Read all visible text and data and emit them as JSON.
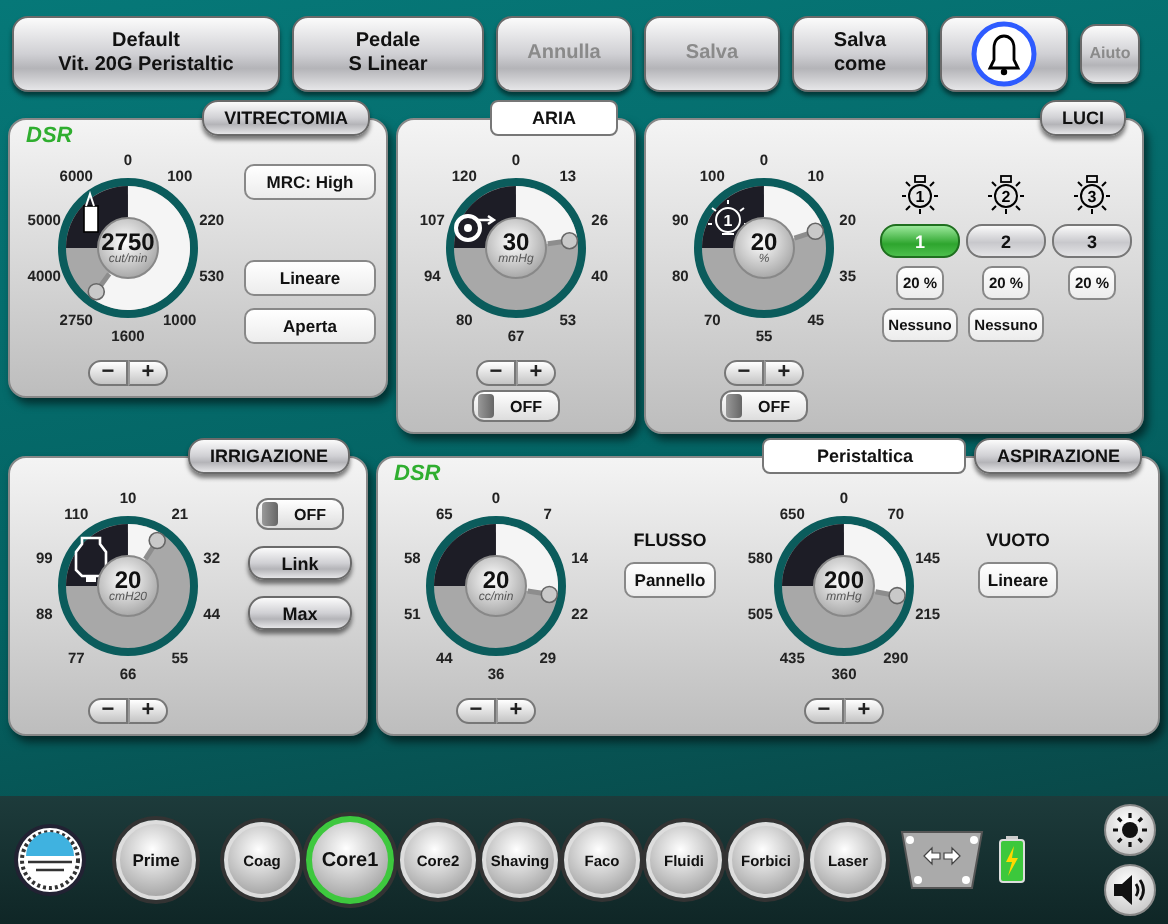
{
  "top_bar": {
    "buttons": [
      {
        "lines": [
          "Default",
          "Vit. 20G Peristaltic"
        ],
        "disabled": false
      },
      {
        "lines": [
          "Pedale",
          "S Linear"
        ],
        "disabled": false
      },
      {
        "lines": [
          "Annulla"
        ],
        "disabled": true
      },
      {
        "lines": [
          "Salva"
        ],
        "disabled": true
      },
      {
        "lines": [
          "Salva",
          "come"
        ],
        "disabled": false
      }
    ],
    "help": {
      "label": "Aiuto",
      "disabled": true
    }
  },
  "vitrectomia": {
    "title": "VITRECTOMIA",
    "brand": "DSR",
    "dial": {
      "value": "2750",
      "unit": "cut/min",
      "ticks": [
        "0",
        "100",
        "220",
        "530",
        "1000",
        "1600",
        "2750",
        "4000",
        "5000",
        "6000"
      ],
      "minus": "−",
      "plus": "+"
    },
    "buttons": [
      "MRC: High",
      "Lineare",
      "Aperta"
    ]
  },
  "aria": {
    "title": "ARIA",
    "dial": {
      "value": "30",
      "unit": "mmHg",
      "ticks": [
        "0",
        "13",
        "26",
        "40",
        "53",
        "67",
        "80",
        "94",
        "107",
        "120"
      ],
      "minus": "−",
      "plus": "+"
    },
    "switch": {
      "label": "OFF",
      "on": false
    }
  },
  "luci": {
    "title": "LUCI",
    "dial": {
      "value": "20",
      "unit": "%",
      "icon_label": "1",
      "ticks": [
        "0",
        "10",
        "20",
        "35",
        "45",
        "55",
        "70",
        "80",
        "90",
        "100"
      ],
      "minus": "−",
      "plus": "+"
    },
    "switch": {
      "label": "OFF",
      "on": false
    },
    "lights": [
      {
        "icon_label": "1",
        "label": "1",
        "selected": true,
        "percent": "20 %",
        "mode": "Nessuno"
      },
      {
        "icon_label": "2",
        "label": "2",
        "selected": false,
        "percent": "20 %",
        "mode": "Nessuno"
      },
      {
        "icon_label": "3",
        "label": "3",
        "selected": false,
        "percent": "20 %"
      }
    ]
  },
  "irrigazione": {
    "title": "IRRIGAZIONE",
    "dial": {
      "value": "20",
      "unit": "cmH20",
      "ticks": [
        "10",
        "21",
        "32",
        "44",
        "55",
        "66",
        "77",
        "88",
        "99",
        "110"
      ],
      "minus": "−",
      "plus": "+"
    },
    "switch": {
      "label": "OFF",
      "on": false
    },
    "buttons": [
      "Link",
      "Max"
    ]
  },
  "aspirazione": {
    "title": "ASPIRAZIONE",
    "mode": "Peristaltica",
    "brand": "DSR",
    "flusso": {
      "label": "FLUSSO",
      "button": "Pannello",
      "dial": {
        "value": "20",
        "unit": "cc/min",
        "ticks": [
          "0",
          "7",
          "14",
          "22",
          "29",
          "36",
          "44",
          "51",
          "58",
          "65"
        ],
        "minus": "−",
        "plus": "+"
      }
    },
    "vuoto": {
      "label": "VUOTO",
      "button": "Lineare",
      "dial": {
        "value": "200",
        "unit": "mmHg",
        "ticks": [
          "0",
          "70",
          "145",
          "215",
          "290",
          "360",
          "435",
          "505",
          "580",
          "650"
        ],
        "minus": "−",
        "plus": "+"
      }
    }
  },
  "bottom_bar": {
    "prime": "Prime",
    "modes": [
      {
        "label": "Coag",
        "selected": false
      },
      {
        "label": "Core1",
        "selected": true
      },
      {
        "label": "Core2",
        "selected": false
      },
      {
        "label": "Shaving",
        "selected": false
      },
      {
        "label": "Faco",
        "selected": false
      },
      {
        "label": "Fluidi",
        "selected": false
      },
      {
        "label": "Forbici",
        "selected": false
      },
      {
        "label": "Laser",
        "selected": false
      }
    ]
  }
}
